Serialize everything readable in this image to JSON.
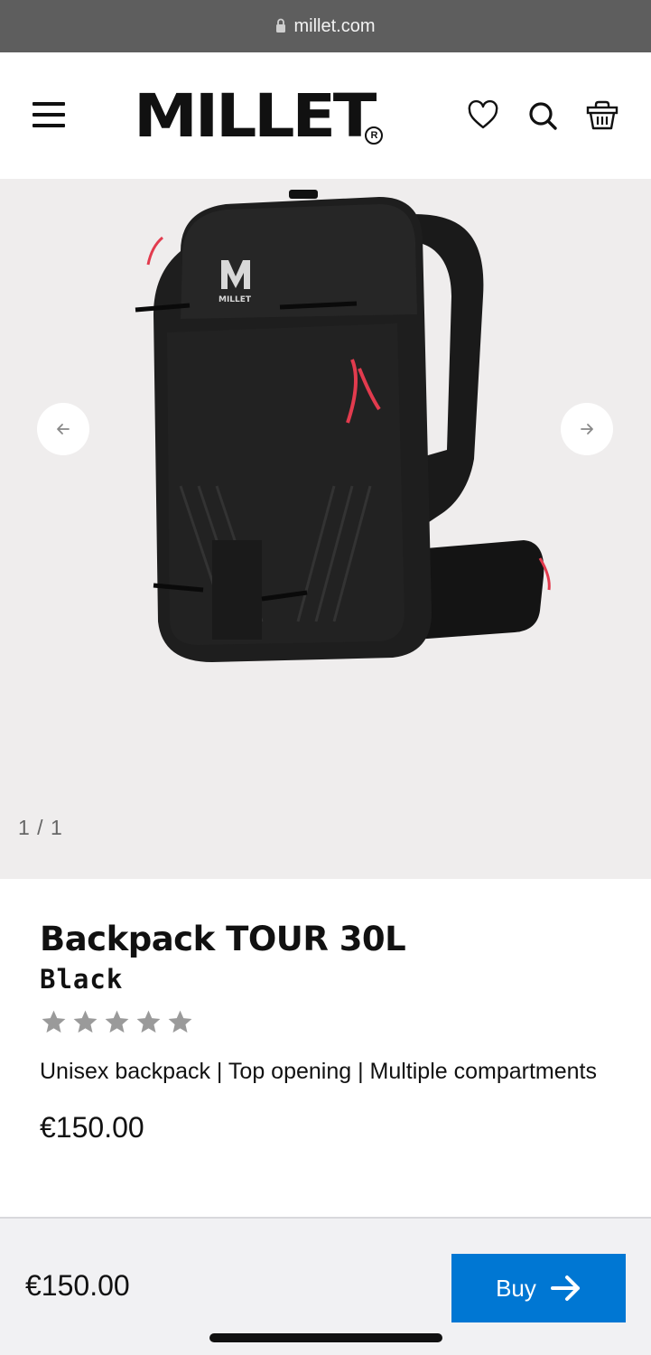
{
  "browser": {
    "url": "millet.com"
  },
  "header": {
    "logo_text": "MILLET",
    "logo_mark": "R"
  },
  "gallery": {
    "counter": "1 / 1",
    "bg_color": "#efeded"
  },
  "product": {
    "title": "Backpack TOUR 30L",
    "colour": "Black",
    "rating": {
      "filled": 0,
      "total": 5
    },
    "description": "Unisex backpack | Top opening | Multiple compartments",
    "price": "€150.00",
    "image_logo_text": "MILLET"
  },
  "buybar": {
    "price": "€150.00",
    "buy_label": "Buy",
    "button_color": "#0077d3"
  }
}
